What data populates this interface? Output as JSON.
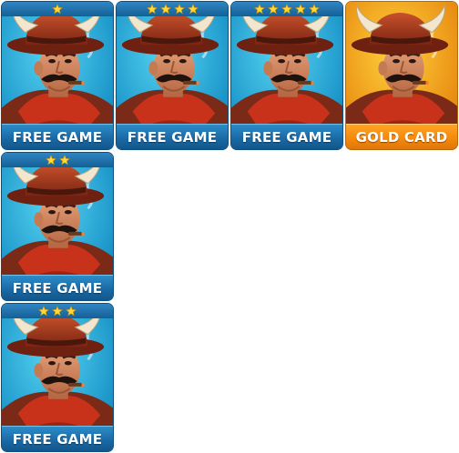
{
  "cards": [
    {
      "label": "FREE GAME",
      "stars": 1,
      "variant": "blue"
    },
    {
      "label": "FREE GAME",
      "stars": 4,
      "variant": "blue"
    },
    {
      "label": "FREE GAME",
      "stars": 5,
      "variant": "blue"
    },
    {
      "label": "GOLD CARD",
      "stars": 0,
      "variant": "gold"
    },
    {
      "label": "FREE GAME",
      "stars": 2,
      "variant": "blue"
    },
    {
      "label": "FREE GAME",
      "stars": 3,
      "variant": "blue"
    }
  ],
  "icons": {
    "star": "star-icon",
    "portrait": "cowboy-portrait"
  },
  "colors": {
    "blue_bg": "#1fa6d6",
    "gold_bg": "#f7a416",
    "star": "#ffd83a",
    "hat": "#a23a1e",
    "bandana": "#c8321b"
  }
}
